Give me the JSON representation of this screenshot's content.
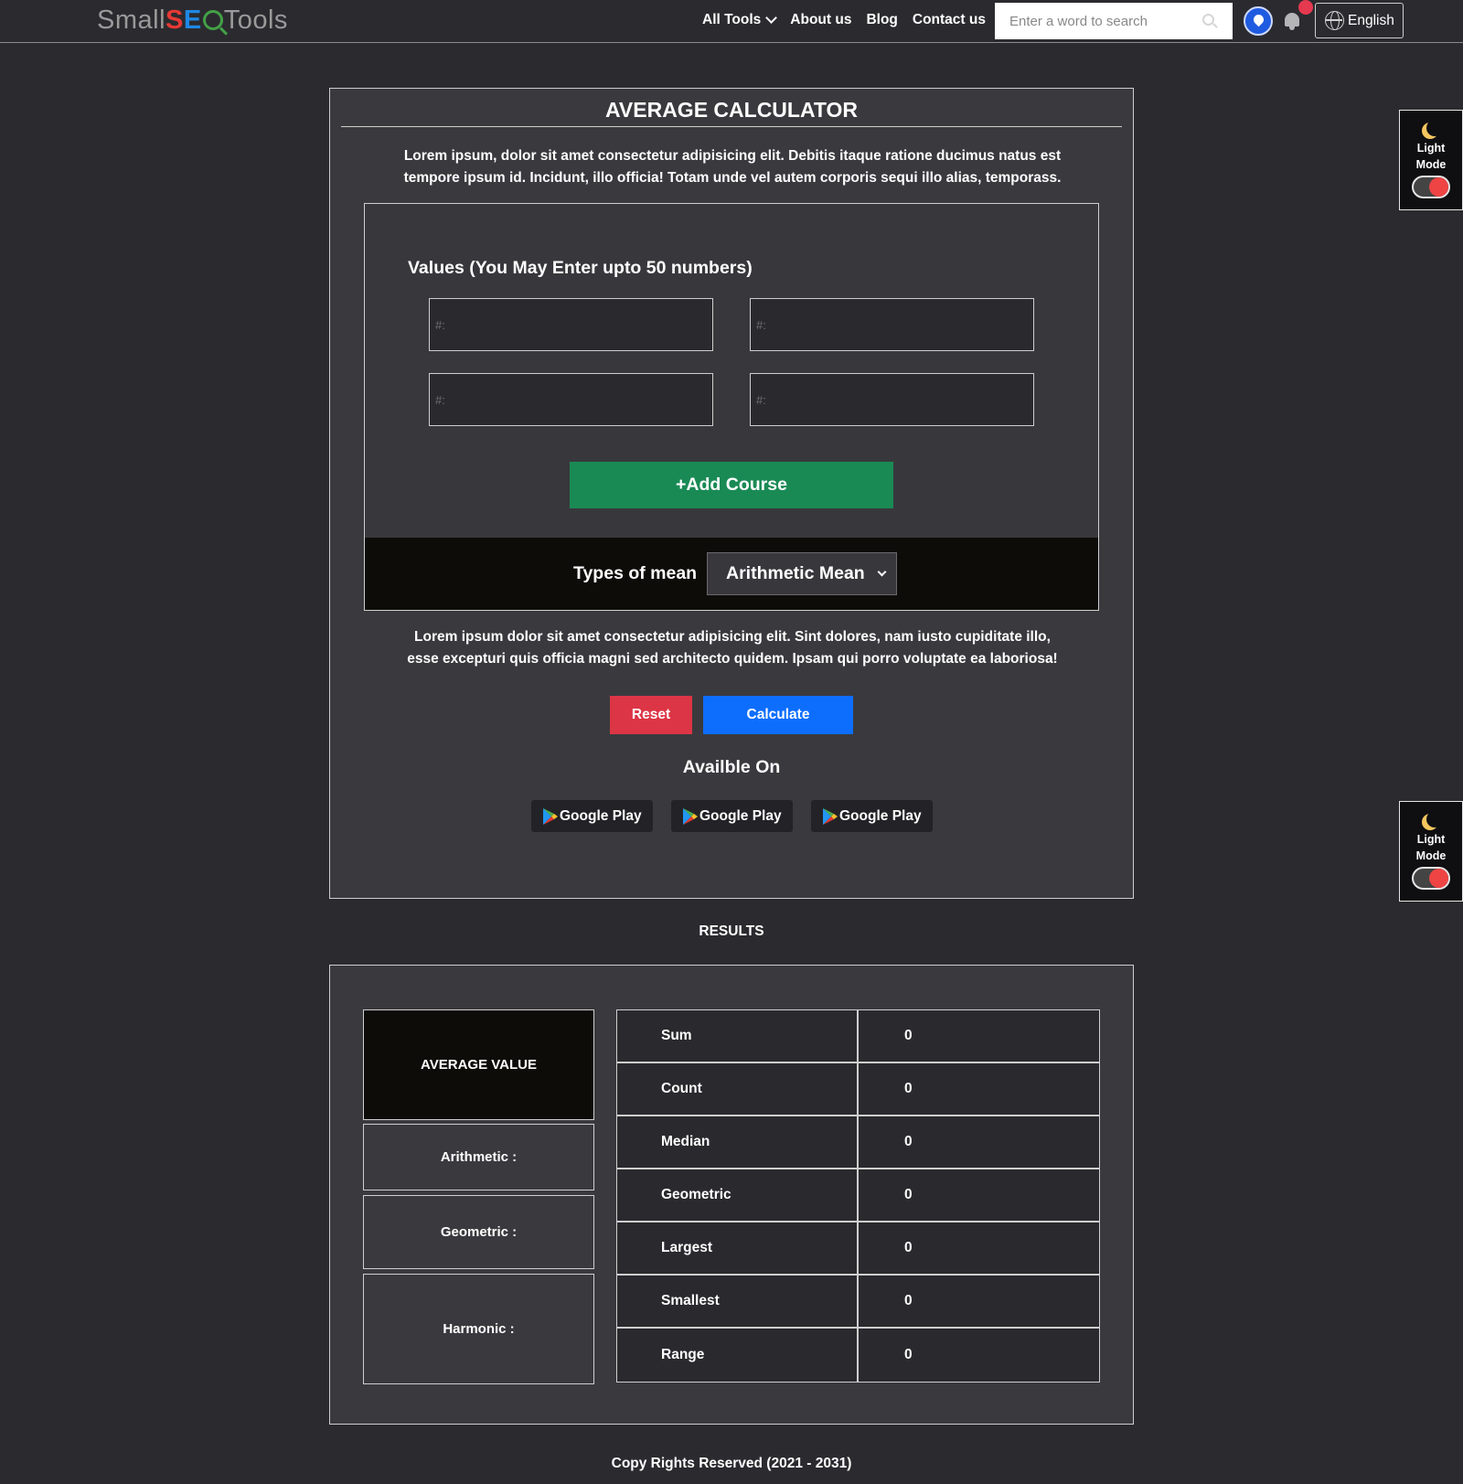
{
  "header": {
    "logo": {
      "small": "Small",
      "seo_s": "S",
      "seo_e": "E",
      "tools": "Tools"
    },
    "nav": [
      "All Tools",
      "About us",
      "Blog",
      "Contact us"
    ],
    "search_placeholder": "Enter a word to search",
    "language": "English"
  },
  "light_mode": {
    "line1": "Light",
    "line2": "Mode"
  },
  "calculator": {
    "title": "AVERAGE CALCULATOR",
    "intro": "Lorem ipsum, dolor sit amet consectetur adipisicing elit. Debitis itaque ratione ducimus natus est tempore ipsum id. Incidunt, illo officia! Totam unde vel autem corporis sequi illo alias, temporass.",
    "values_label": "Values (You May Enter upto 50 numbers)",
    "input_placeholder": "#:",
    "add_button": "+Add Course",
    "mean_label": "Types of mean",
    "mean_selected": "Arithmetic Mean",
    "outro": "Lorem ipsum dolor sit amet consectetur adipisicing elit. Sint dolores, nam iusto cupiditate illo, esse excepturi quis officia magni sed architecto quidem. Ipsam qui porro voluptate ea laboriosa!",
    "reset": "Reset",
    "calculate": "Calculate",
    "available_on": "Availble On",
    "store_buttons": [
      "Google Play",
      "Google Play",
      "Google Play"
    ]
  },
  "results": {
    "title": "RESULTS",
    "average_value": "AVERAGE VALUE",
    "arithmetic": "Arithmetic :",
    "geometric": "Geometric :",
    "harmonic": "Harmonic :",
    "stats": [
      {
        "label": "Sum",
        "value": "0"
      },
      {
        "label": "Count",
        "value": "0"
      },
      {
        "label": "Median",
        "value": "0"
      },
      {
        "label": "Geometric",
        "value": "0"
      },
      {
        "label": "Largest",
        "value": "0"
      },
      {
        "label": "Smallest",
        "value": "0"
      },
      {
        "label": "Range",
        "value": "0"
      }
    ]
  },
  "footer": "Copy Rights Reserved (2021 - 2031)",
  "colors": {
    "background": "#2b2b2f",
    "panel": "#3a3a3e",
    "add_button": "#1a8a55",
    "reset_button": "#dc3545",
    "calculate_button": "#0d6efd"
  }
}
